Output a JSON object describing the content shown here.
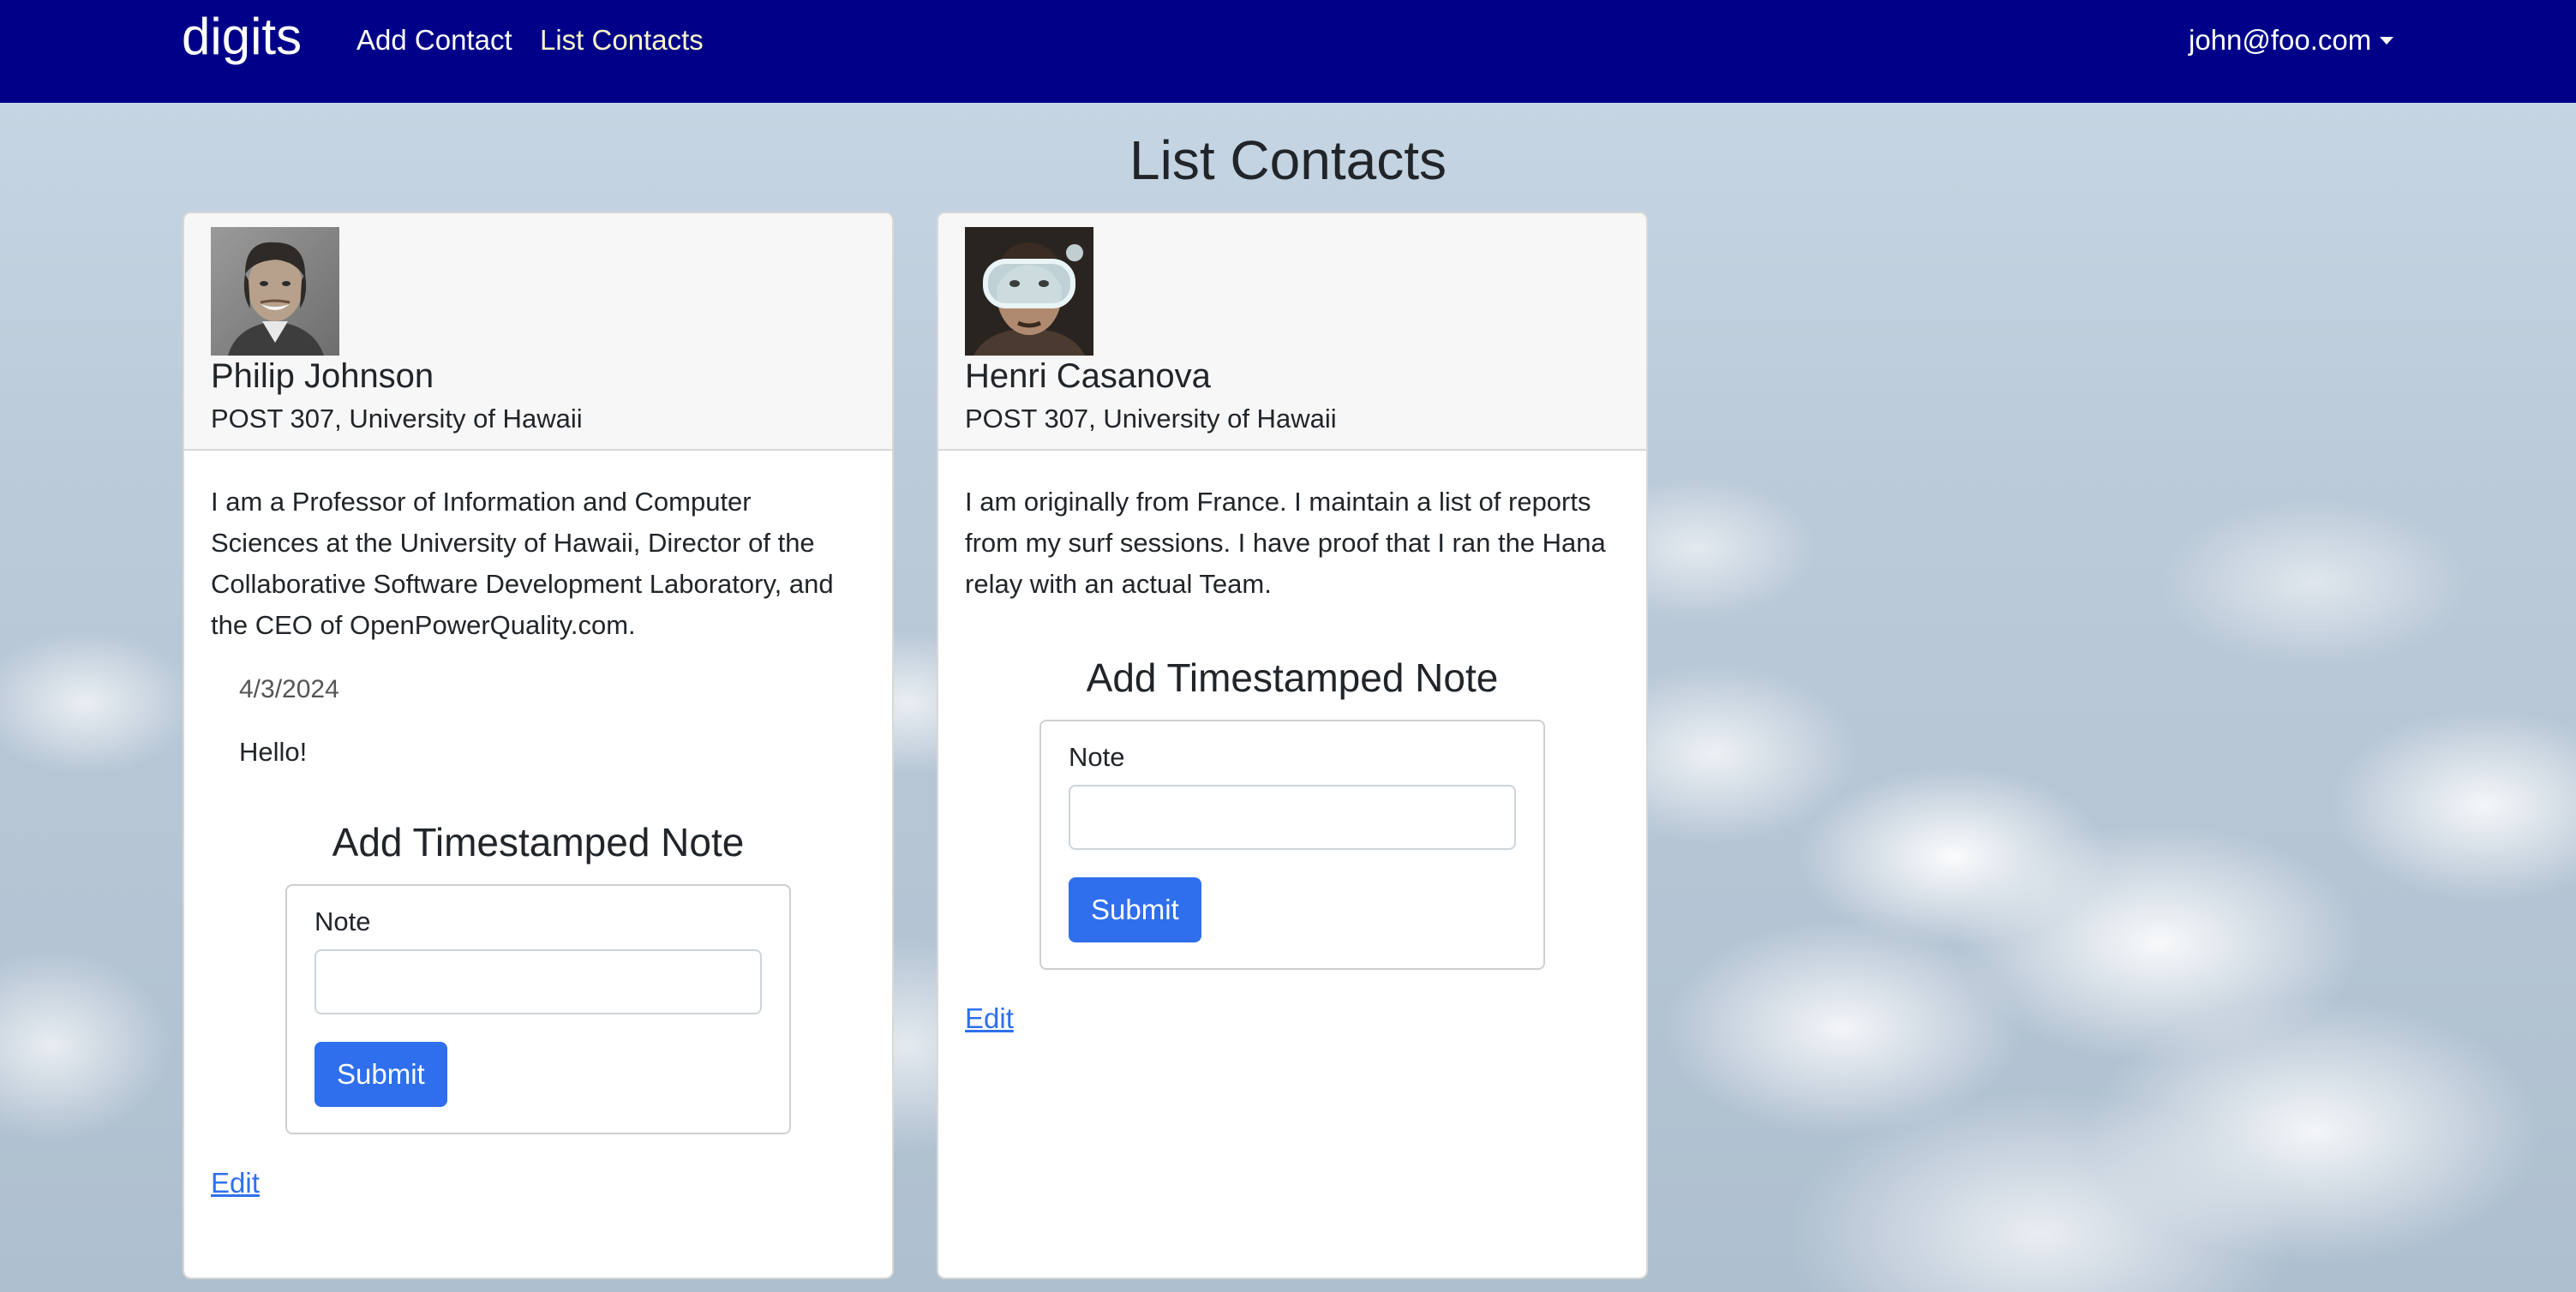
{
  "navbar": {
    "brand": "digits",
    "links": [
      {
        "label": "Add Contact"
      },
      {
        "label": "List Contacts"
      }
    ],
    "user": "john@foo.com"
  },
  "page": {
    "title": "List Contacts"
  },
  "contacts": [
    {
      "name": "Philip Johnson",
      "address": "POST 307, University of Hawaii",
      "description": "I am a Professor of Information and Computer Sciences at the University of Hawaii, Director of the Collaborative Software Development Laboratory, and the CEO of OpenPowerQuality.com.",
      "notes": [
        {
          "date": "4/3/2024",
          "text": "Hello!"
        }
      ],
      "add_note_title": "Add Timestamped Note",
      "note_label": "Note",
      "note_value": "",
      "submit_label": "Submit",
      "edit_label": "Edit"
    },
    {
      "name": "Henri Casanova",
      "address": "POST 307, University of Hawaii",
      "description": "I am originally from France. I maintain a list of reports from my surf sessions. I have proof that I ran the Hana relay with an actual Team.",
      "notes": [],
      "add_note_title": "Add Timestamped Note",
      "note_label": "Note",
      "note_value": "",
      "submit_label": "Submit",
      "edit_label": "Edit"
    }
  ],
  "colors": {
    "navbar": "#000088",
    "active_link": "#fbf7c8",
    "button": "#2f6fed",
    "link": "#2f6fed"
  }
}
